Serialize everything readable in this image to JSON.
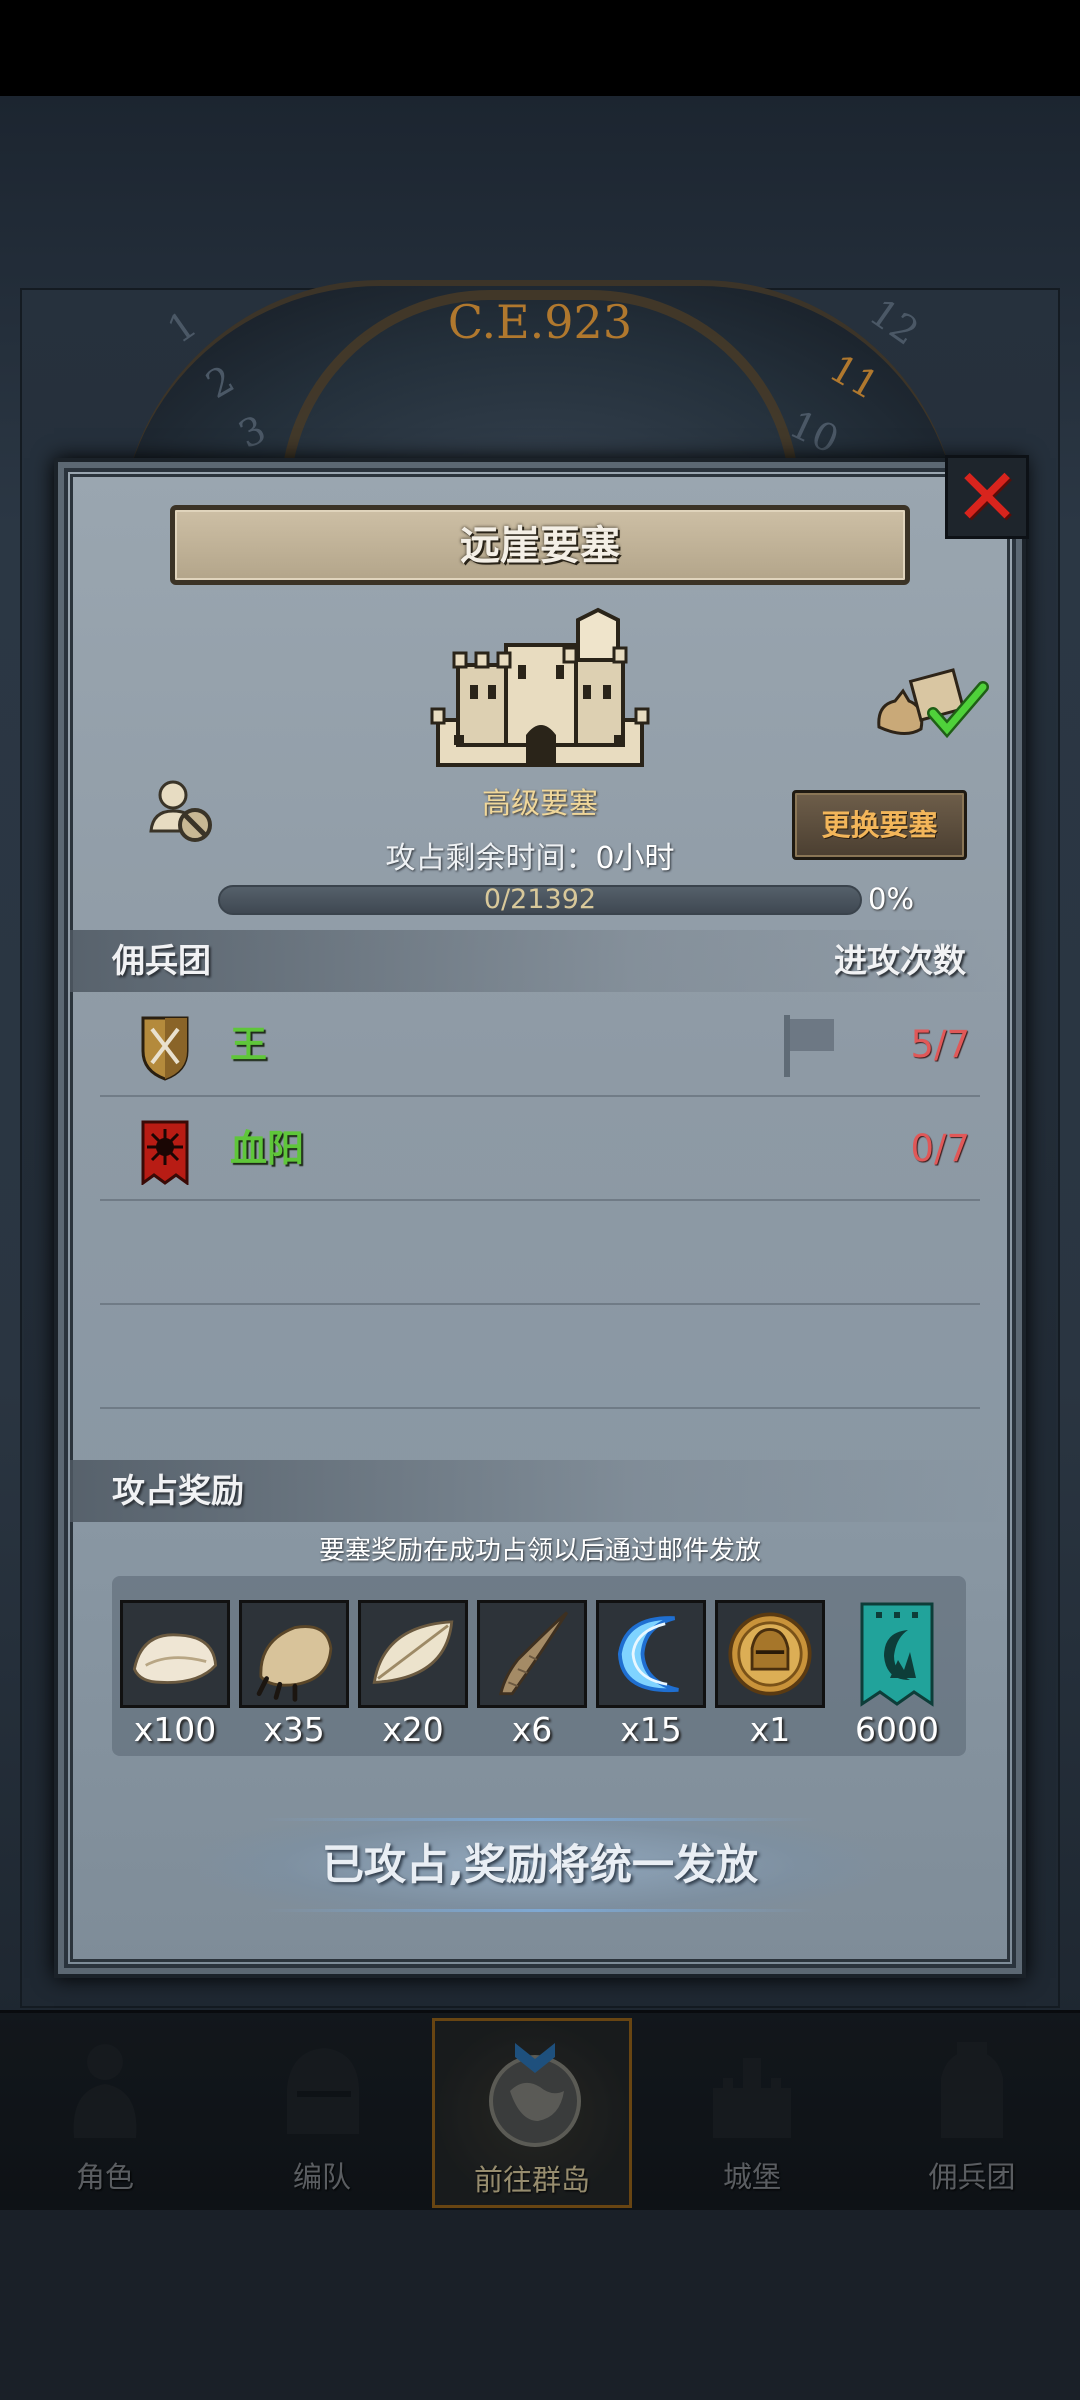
{
  "background": {
    "era_label": "C.E.923",
    "clock_numbers": [
      "1",
      "2",
      "3",
      "11",
      "12",
      "10"
    ]
  },
  "dialog": {
    "title": "远崖要塞",
    "fortress_level": "高级要塞",
    "change_button": "更换要塞",
    "timer": {
      "label": "攻占剩余时间：",
      "value": "0小时"
    },
    "progress": {
      "text": "0/21392",
      "current": 0,
      "total": 21392,
      "percent_label": "0%"
    },
    "mercenary_section": {
      "header_left": "佣兵团",
      "header_right": "进攻次数",
      "rows": [
        {
          "name": "王",
          "attacks": "5/7",
          "crest": "sword-shield-crest-icon",
          "has_flag": true
        },
        {
          "name": "血阳",
          "attacks": "0/7",
          "crest": "red-sun-banner-icon",
          "has_flag": false
        }
      ]
    },
    "reward_section": {
      "header": "攻占奖励",
      "note": "要塞奖励在成功占领以后通过邮件发放",
      "items": [
        {
          "icon": "white-fur-icon",
          "qty": "x100"
        },
        {
          "icon": "claw-paw-icon",
          "qty": "x35"
        },
        {
          "icon": "feather-scale-icon",
          "qty": "x20"
        },
        {
          "icon": "horn-icon",
          "qty": "x6"
        },
        {
          "icon": "blue-crescent-icon",
          "qty": "x15"
        },
        {
          "icon": "golden-helmet-coin-icon",
          "qty": "x1"
        },
        {
          "icon": "guild-banner-icon",
          "qty": "6000"
        }
      ]
    },
    "claim_status": "已攻占,奖励将统一发放"
  },
  "bottom_nav": {
    "items": [
      {
        "label": "角色",
        "icon": "knight-icon",
        "active": false
      },
      {
        "label": "编队",
        "icon": "helmet-icon",
        "active": false
      },
      {
        "label": "前往群岛",
        "icon": "globe-icon",
        "active": true
      },
      {
        "label": "城堡",
        "icon": "castle-icon",
        "active": false
      },
      {
        "label": "佣兵团",
        "icon": "mercenary-icon",
        "active": false
      }
    ]
  },
  "colors": {
    "accent_orange": "#f3b65a",
    "name_green": "#5fc63a",
    "count_red": "#e05858",
    "close_red": "#d8241d"
  }
}
